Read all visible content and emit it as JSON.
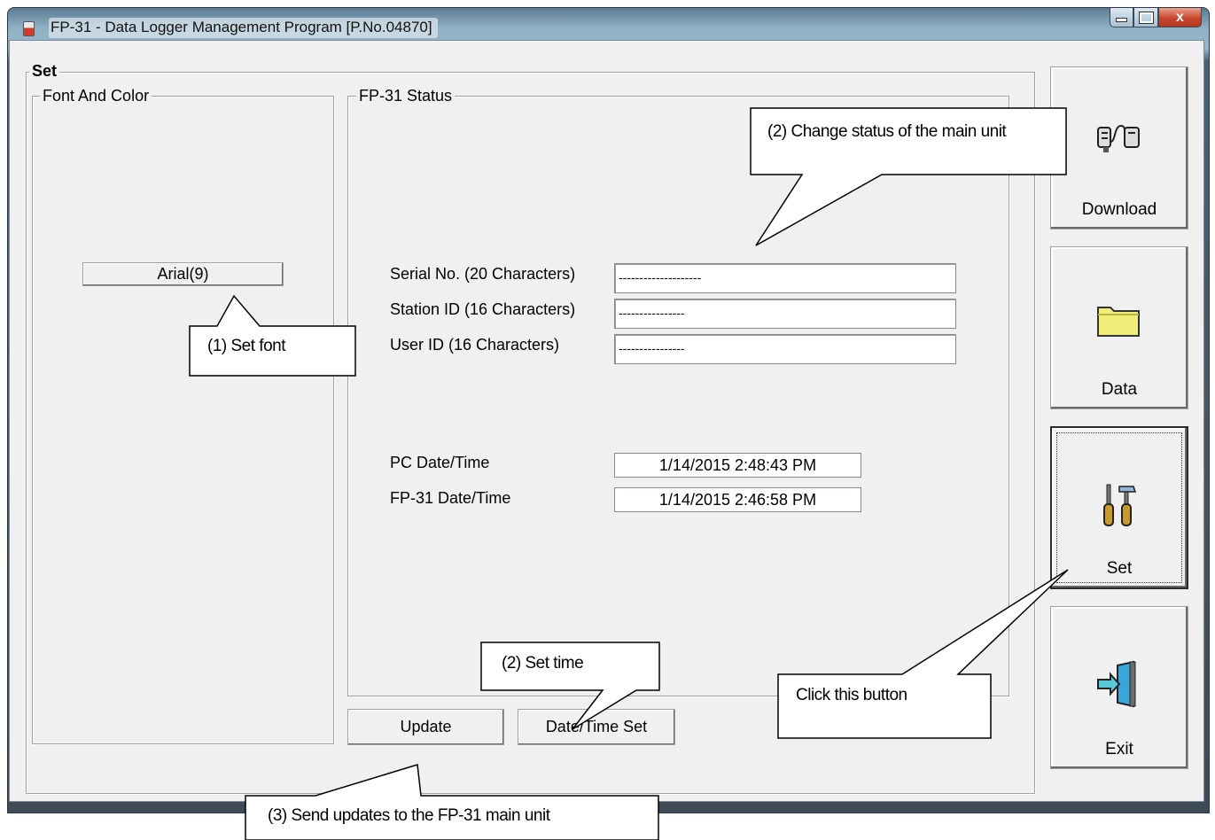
{
  "window": {
    "title": "FP-31  - Data Logger Management Program [P.No.04870]",
    "close_glyph": "x"
  },
  "set_group": {
    "title": "Set"
  },
  "font_group": {
    "title": "Font And Color",
    "font_button": "Arial(9)"
  },
  "status_group": {
    "title": "FP-31 Status",
    "serial_label": "Serial No. (20 Characters)",
    "serial_value": "--------------------",
    "station_label": "Station ID (16 Characters)",
    "station_value": "----------------",
    "user_label": "User ID (16 Characters)",
    "user_value": "----------------",
    "pc_dt_label": "PC Date/Time",
    "pc_dt_value": "1/14/2015 2:48:43 PM",
    "fp_dt_label": "FP-31 Date/Time",
    "fp_dt_value": "1/14/2015 2:46:58 PM"
  },
  "buttons": {
    "update": "Update",
    "datetime_set": "Date/Time Set"
  },
  "sidebar": {
    "items": [
      {
        "label": "Download",
        "icon": "download-icon"
      },
      {
        "label": "Data",
        "icon": "folder-icon"
      },
      {
        "label": "Set",
        "icon": "tools-icon",
        "active": true
      },
      {
        "label": "Exit",
        "icon": "exit-door-icon"
      }
    ]
  },
  "callouts": {
    "set_font": "(1) Set font",
    "change_status": "(2) Change status of the main unit",
    "set_time": "(2) Set time",
    "click_button": "Click this button",
    "send_updates": "(3) Send updates to the FP-31 main unit"
  }
}
